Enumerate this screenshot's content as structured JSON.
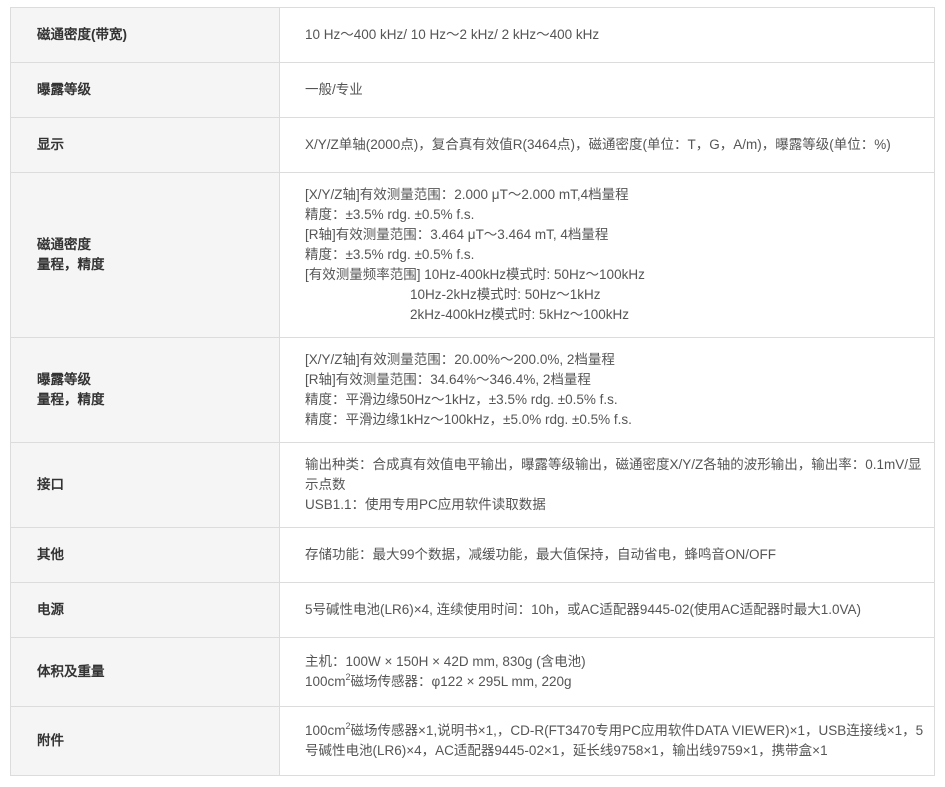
{
  "rows": [
    {
      "label": [
        "磁通密度(带宽)"
      ],
      "value": "10 Hz～400 kHz/ 10 Hz～2 kHz/ 2 kHz～400 kHz"
    },
    {
      "label": [
        "曝露等级"
      ],
      "value": "一般/专业"
    },
    {
      "label": [
        "显示"
      ],
      "value": "X/Y/Z单轴(2000点)，复合真有效值R(3464点)，磁通密度(单位：T，G，A/m)，曝露等级(单位：%)"
    },
    {
      "label": [
        "磁通密度",
        "量程，精度"
      ],
      "lines": [
        "[X/Y/Z轴]有效测量范围：2.000 μT～2.000 mT,4档量程",
        "精度：±3.5% rdg. ±0.5% f.s.",
        "[R轴]有效测量范围：3.464 μT～3.464 mT, 4档量程",
        "精度：±3.5% rdg. ±0.5% f.s.",
        "[有效测量频率范围] 10Hz-400kHz模式时: 50Hz～100kHz",
        "10Hz-2kHz模式时: 50Hz～1kHz",
        "2kHz-400kHz模式时: 5kHz～100kHz"
      ]
    },
    {
      "label": [
        "曝露等级",
        "量程，精度"
      ],
      "lines": [
        "[X/Y/Z轴]有效测量范围：20.00%～200.0%, 2档量程",
        "[R轴]有效测量范围：34.64%～346.4%, 2档量程",
        "精度：平滑边缘50Hz～1kHz，±3.5% rdg. ±0.5% f.s.",
        "精度：平滑边缘1kHz～100kHz，±5.0% rdg. ±0.5% f.s."
      ]
    },
    {
      "label": [
        "接口"
      ],
      "lines": [
        "输出种类：合成真有效值电平输出，曝露等级输出，磁通密度X/Y/Z各轴的波形输出，输出率：0.1mV/显示点数",
        "USB1.1：使用专用PC应用软件读取数据"
      ]
    },
    {
      "label": [
        "其他"
      ],
      "value": "存储功能：最大99个数据，减缓功能，最大值保持，自动省电，蜂鸣音ON/OFF"
    },
    {
      "label": [
        "电源"
      ],
      "value": "5号碱性电池(LR6)×4, 连续使用时间：10h，或AC适配器9445-02(使用AC适配器时最大1.0VA)"
    },
    {
      "label": [
        "体积及重量"
      ],
      "line1": "主机：100W × 150H × 42D mm, 830g (含电池)",
      "line2_pre": "100cm",
      "line2_sup": "2",
      "line2_post": "磁场传感器：φ122 × 295L mm, 220g"
    },
    {
      "label": [
        "附件"
      ],
      "pre": "100cm",
      "sup": "2",
      "post": "磁场传感器×1,说明书×1,，CD-R(FT3470专用PC应用软件DATA VIEWER)×1，USB连接线×1，5号碱性电池(LR6)×4，AC适配器9445-02×1，延长线9758×1，输出线9759×1，携带盒×1"
    }
  ]
}
